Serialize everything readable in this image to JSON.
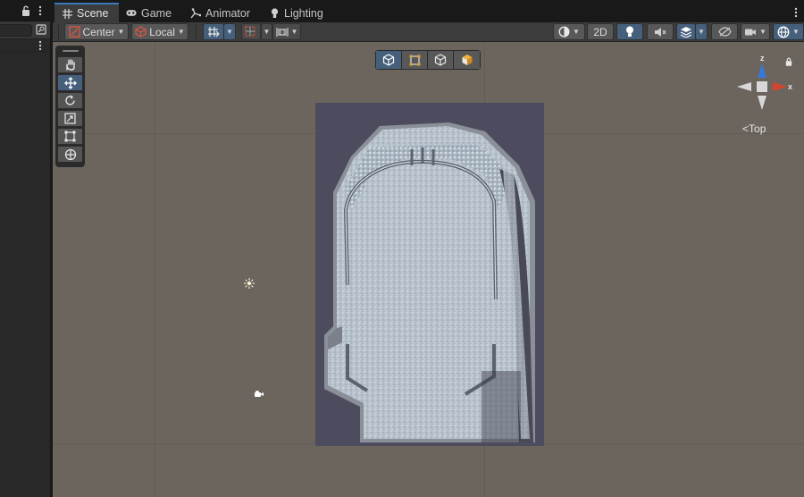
{
  "tabs": [
    {
      "label": "Scene",
      "icon": "grid-icon",
      "active": true
    },
    {
      "label": "Game",
      "icon": "gamepad-icon",
      "active": false
    },
    {
      "label": "Animator",
      "icon": "animator-icon",
      "active": false
    },
    {
      "label": "Lighting",
      "icon": "lightbulb-icon",
      "active": false
    }
  ],
  "toolbar": {
    "pivot_label": "Center",
    "space_label": "Local",
    "mode_2d_label": "2D"
  },
  "tools": [
    "hand-tool",
    "move-tool",
    "rotate-tool",
    "scale-tool",
    "rect-tool",
    "transform-tool"
  ],
  "overlay_buttons": [
    "cube-outline",
    "rect-select",
    "cube-wire",
    "cube-solid"
  ],
  "gizmo": {
    "view_label": "Top",
    "axis_z": "z",
    "axis_x": "x"
  },
  "colors": {
    "accent": "#46607c",
    "tab_active_border": "#3a79bb",
    "viewport_bg": "#6b655d",
    "level_floor": "#b6c1cc",
    "level_bg": "#4b4b5c",
    "axis_x": "#d6432f",
    "axis_z": "#3a78d8"
  }
}
